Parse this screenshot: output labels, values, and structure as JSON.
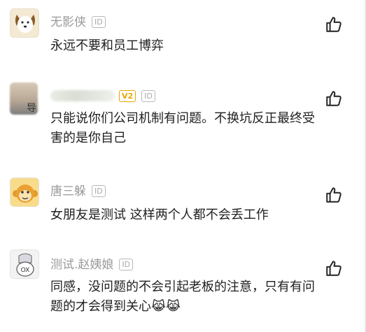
{
  "comments": [
    {
      "username": "无影侠",
      "id_badge": "ID",
      "content": "永远不要和员工博弈",
      "avatar_icon": "dog-face-icon",
      "like_icon": "thumbs-up-icon"
    },
    {
      "username": "",
      "username_tail": "导",
      "level_badge": "V2",
      "id_badge": "ID",
      "content": "只能说你们公司机制有问题。不换坑反正最终受害的是你自己",
      "avatar_icon": "blurred-photo-avatar",
      "like_icon": "thumbs-up-icon"
    },
    {
      "username": "唐三躲",
      "id_badge": "ID",
      "content": "女朋友是测试  这样两个人都不会丢工作",
      "avatar_icon": "monkey-face-icon",
      "like_icon": "thumbs-up-icon"
    },
    {
      "username": "测试.赵姨娘",
      "id_badge": "ID",
      "content": "同感，没问题的不会引起老板的注意，只有有问题的才会得到关心😹😹",
      "avatar_icon": "ox-character-icon",
      "like_icon": "thumbs-up-icon"
    }
  ]
}
